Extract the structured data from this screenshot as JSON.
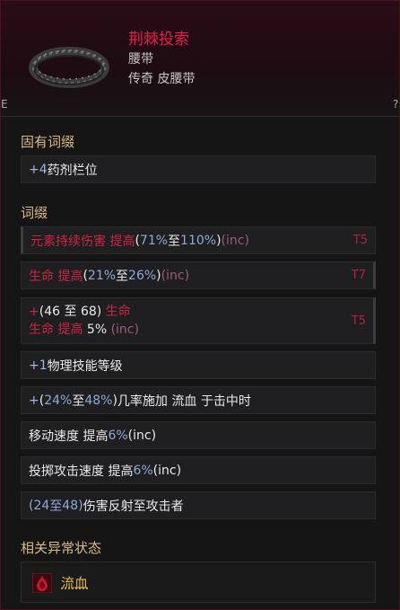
{
  "item": {
    "name": "荆棘投索",
    "type": "腰带",
    "rarity": "传奇 皮腰带"
  },
  "edge": {
    "right_a": "E",
    "right_b": "?"
  },
  "sections": {
    "implicit_title": "固有词缀",
    "affix_title": "词缀",
    "status_title": "相关异常状态"
  },
  "implicit": [
    {
      "plus": "+",
      "value": "4",
      "text": " 药剂栏位"
    }
  ],
  "affixes": [
    {
      "lead": "元素持续伤害 提高 ",
      "range": [
        "(",
        "71%",
        " 至 ",
        "110%",
        ")"
      ],
      "suffix": " (inc)",
      "tier": "T5"
    },
    {
      "lead": "生命 提高 ",
      "range": [
        "(",
        "21%",
        " 至 ",
        "26%",
        ")"
      ],
      "suffix": " (inc)",
      "tier": "T7"
    },
    {
      "line1_plus": "+",
      "line1_range": [
        "(",
        "46",
        " 至 ",
        "68",
        ")"
      ],
      "line1_text": " 生命",
      "line2_text": "生命 提高 ",
      "line2_value": "5%",
      "line2_suffix": " (inc)",
      "tier": "T5"
    },
    {
      "plus": "+",
      "value": "1",
      "text": " 物理技能等级"
    },
    {
      "plus": "+",
      "range": [
        "(",
        "24%",
        " 至 ",
        "48%",
        ")"
      ],
      "text": " 几率施加 流血 于击中时"
    },
    {
      "text": "移动速度 提高 ",
      "value": "6%",
      "suffix": " (inc)"
    },
    {
      "text": "投掷攻击速度 提高 ",
      "value": "6%",
      "suffix": " (inc)"
    },
    {
      "range": [
        "(",
        "24",
        " 至 ",
        "48",
        ")"
      ],
      "text": " 伤害反射至攻击者"
    }
  ],
  "status": {
    "label": "流血",
    "icon": "bleed-icon"
  },
  "colors": {
    "accent": "#e0224a",
    "tier": "#b6223e",
    "value_blue": "#8fa9d6",
    "section": "#d9b98a"
  }
}
